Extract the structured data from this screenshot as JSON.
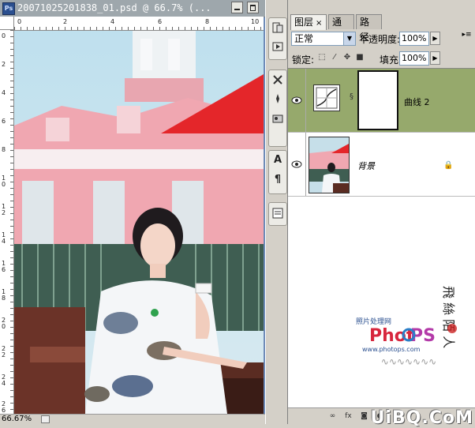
{
  "document": {
    "title": "20071025201838_01.psd @ 66.7% (...",
    "app_icon": "Ps",
    "zoom": "66.67%",
    "ruler_h_labels": [
      "0",
      "2",
      "4",
      "6",
      "8",
      "10"
    ],
    "ruler_v_labels": [
      "0",
      "2",
      "4",
      "6",
      "8",
      "1 0",
      "1 2",
      "1 4",
      "1 6",
      "1 8",
      "2 0",
      "2 2",
      "2 4",
      "2 6"
    ]
  },
  "toolstrip": {
    "icons": [
      "history-icon",
      "actions-icon",
      "tools-preset-icon",
      "brushes-icon",
      "clone-source-icon",
      "character-icon",
      "paragraph-icon",
      "layer-comps-icon"
    ],
    "char_glyph": "A",
    "para_glyph": "¶"
  },
  "layers_panel": {
    "tabs": [
      {
        "label": "图层",
        "close": "×",
        "active": true
      },
      {
        "label": "通道",
        "active": false
      },
      {
        "label": "路径",
        "active": false
      }
    ],
    "blend_mode": "正常",
    "opacity_label": "不透明度:",
    "opacity_value": "100%",
    "lock_label": "锁定:",
    "fill_label": "填充:",
    "fill_value": "100%",
    "layers": [
      {
        "name": "曲线 2",
        "type": "curves-adjustment",
        "selected": true,
        "visible": true
      },
      {
        "name": "背景",
        "type": "background",
        "selected": false,
        "visible": true,
        "locked": true
      }
    ],
    "watermark": {
      "site_label": "照片处理网",
      "logo": "PhotoPS",
      "url": "www.photops.com"
    }
  },
  "branding": {
    "text": "UiBQ.CoM"
  },
  "colors": {
    "selected_layer": "#96a96c",
    "panel_bg": "#d4d0c8",
    "titlebar": "#9ea7ac"
  }
}
